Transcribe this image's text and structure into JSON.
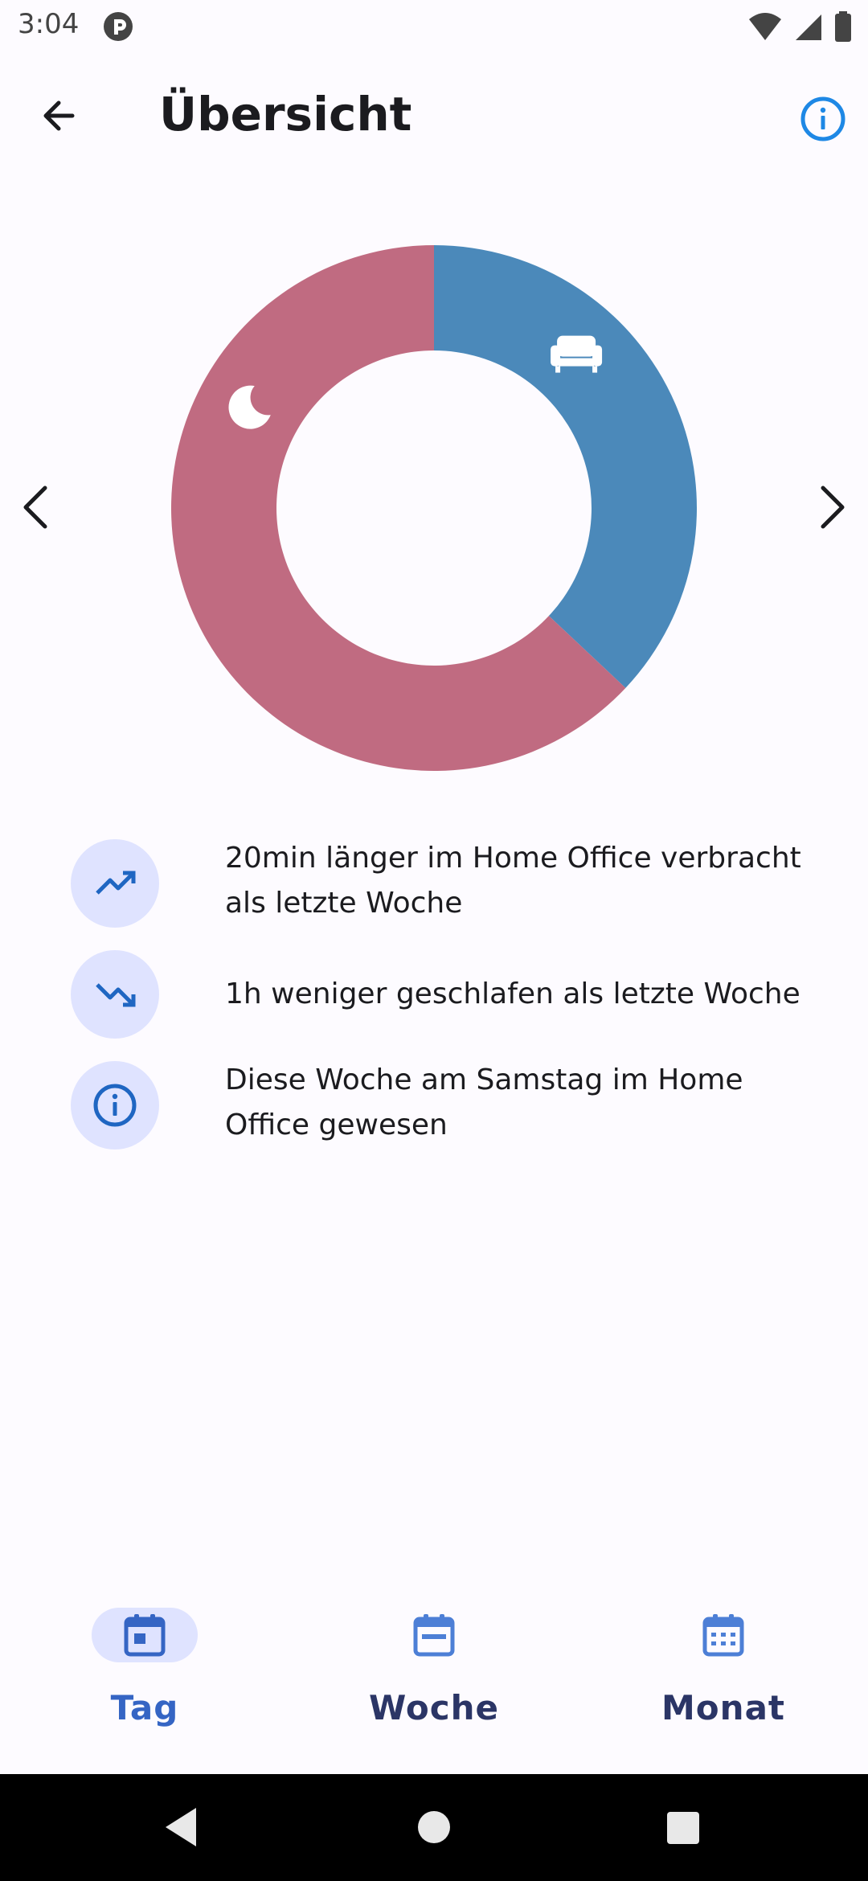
{
  "status_bar": {
    "time": "3:04",
    "icons": [
      "app-notification-icon",
      "wifi-icon",
      "signal-icon",
      "battery-icon"
    ]
  },
  "app_bar": {
    "title": "Übersicht",
    "back_icon": "arrow-back-icon",
    "info_icon": "info-circle-icon"
  },
  "chart_data": {
    "type": "pie",
    "variant": "donut",
    "series": [
      {
        "name": "Home Office",
        "icon": "sofa-icon",
        "value": 37,
        "color": "#4b89ba"
      },
      {
        "name": "Schlafen",
        "icon": "moon-icon",
        "value": 63,
        "color": "#c06b81"
      }
    ],
    "start": "top",
    "direction": "clockwise",
    "navigation": [
      "chevron-left-icon",
      "chevron-right-icon"
    ]
  },
  "insights": [
    {
      "icon": "trending-up-icon",
      "text": "20min länger im Home Office verbracht als letzte Woche"
    },
    {
      "icon": "trending-down-icon",
      "text": "1h weniger geschlafen als letzte Woche"
    },
    {
      "icon": "info-circle-icon",
      "text": "Diese Woche am Samstag im Home Office gewesen"
    }
  ],
  "bottom_nav": {
    "items": [
      {
        "label": "Tag",
        "icon": "calendar-day-icon",
        "active": true
      },
      {
        "label": "Woche",
        "icon": "calendar-week-icon",
        "active": false
      },
      {
        "label": "Monat",
        "icon": "calendar-month-icon",
        "active": false
      }
    ]
  },
  "colors": {
    "accent": "#1976d2",
    "nav_active": "#3565c4",
    "nav_inactive": "#2b3566",
    "icon_bubble": "#dfe3ff",
    "background": "#fdfbff"
  },
  "system_nav": [
    "back-triangle-icon",
    "home-circle-icon",
    "recents-square-icon"
  ]
}
